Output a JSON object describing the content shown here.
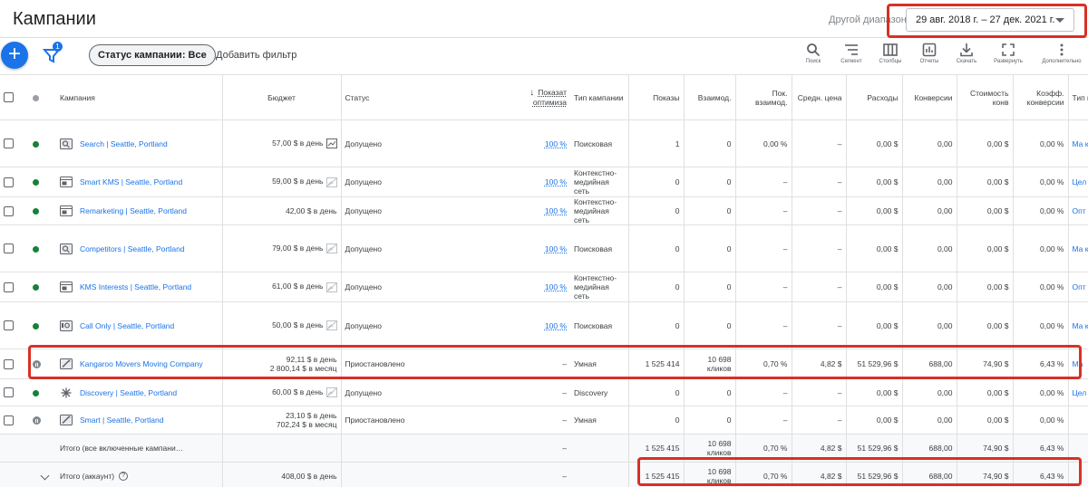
{
  "header": {
    "title": "Кампании",
    "date_range_label": "Другой диапазон",
    "date_range_value": "29 авг. 2018 г. – 27 дек. 2021 г."
  },
  "toolbar": {
    "add_label": "+",
    "filter_count": "1",
    "status_chip": "Статус кампании: Все",
    "add_filter": "Добавить фильтр",
    "tools": [
      {
        "label": "Поиск",
        "icon": "search-icon"
      },
      {
        "label": "Сегмент",
        "icon": "segment-icon"
      },
      {
        "label": "Столбцы",
        "icon": "columns-icon"
      },
      {
        "label": "Отчеты",
        "icon": "reports-icon"
      },
      {
        "label": "Скачать",
        "icon": "download-icon"
      },
      {
        "label": "Развернуть",
        "icon": "expand-icon"
      },
      {
        "label": "Дополнительно",
        "icon": "more-icon"
      }
    ]
  },
  "table": {
    "headers": {
      "campaign": "Кампания",
      "budget": "Бюджет",
      "status": "Статус",
      "opt_score": "Показат оптимиза",
      "type": "Тип кампании",
      "impr": "Показы",
      "interactions": "Взаимод.",
      "int_rate": "Пок. взаимод.",
      "avg_cost": "Средн. цена",
      "cost": "Расходы",
      "conv": "Конверсии",
      "cost_conv": "Стоимость конв",
      "conv_rate": "Коэфф. конверсии",
      "bid": "Тип назн стр"
    },
    "rows": [
      {
        "name": "Search | Seattle, Portland",
        "icon": "search-campaign-icon",
        "status_dot": "green",
        "budget1": "57,00 $ в день",
        "budget2": "",
        "budget_icon": "chart-icon",
        "status": "Допущено",
        "opt": "100 %",
        "type": "Поисковая",
        "impr": "1",
        "inter": "0",
        "int_rate": "0,00 %",
        "avg_cost": "–",
        "cost": "0,00 $",
        "conv": "0,00",
        "cost_conv": "0,00 $",
        "conv_rate": "0,00 %",
        "bid": "Ма кон (це из ста"
      },
      {
        "name": "Smart KMS | Seattle, Portland",
        "icon": "display-campaign-icon",
        "status_dot": "green",
        "budget1": "59,00 $ в день",
        "budget2": "",
        "budget_icon": "no-image-icon",
        "status": "Допущено",
        "opt": "100 %",
        "type": "Контекстно-медийная сеть",
        "impr": "0",
        "inter": "0",
        "int_rate": "–",
        "avg_cost": "–",
        "cost": "0,00 $",
        "conv": "0,00",
        "cost_conv": "0,00 $",
        "conv_rate": "0,00 %",
        "bid": "Цел за к"
      },
      {
        "name": "Remarketing | Seattle, Portland",
        "icon": "display-campaign-icon",
        "status_dot": "green",
        "budget1": "42,00 $ в день",
        "budget2": "",
        "budget_icon": "",
        "status": "Допущено",
        "opt": "100 %",
        "type": "Контекстно-медийная сеть",
        "impr": "0",
        "inter": "0",
        "int_rate": "–",
        "avg_cost": "–",
        "cost": "0,00 $",
        "conv": "0,00",
        "cost_conv": "0,00 $",
        "conv_rate": "0,00 %",
        "bid": "Опт"
      },
      {
        "name": "Competitors | Seattle, Portland",
        "icon": "search-campaign-icon",
        "status_dot": "green",
        "budget1": "79,00 $ в день",
        "budget2": "",
        "budget_icon": "no-image-icon",
        "status": "Допущено",
        "opt": "100 %",
        "type": "Поисковая",
        "impr": "0",
        "inter": "0",
        "int_rate": "–",
        "avg_cost": "–",
        "cost": "0,00 $",
        "conv": "0,00",
        "cost_conv": "0,00 $",
        "conv_rate": "0,00 %",
        "bid": "Ма кон (це из ста"
      },
      {
        "name": "KMS Interests | Seattle, Portland",
        "icon": "display-campaign-icon",
        "status_dot": "green",
        "budget1": "61,00 $ в день",
        "budget2": "",
        "budget_icon": "no-image-icon",
        "status": "Допущено",
        "opt": "100 %",
        "type": "Контекстно-медийная сеть",
        "impr": "0",
        "inter": "0",
        "int_rate": "–",
        "avg_cost": "–",
        "cost": "0,00 $",
        "conv": "0,00",
        "cost_conv": "0,00 $",
        "conv_rate": "0,00 %",
        "bid": "Опт"
      },
      {
        "name": "Call Only | Seattle, Portland",
        "icon": "call-campaign-icon",
        "status_dot": "green",
        "budget1": "50,00 $ в день",
        "budget2": "",
        "budget_icon": "no-image-icon",
        "status": "Допущено",
        "opt": "100 %",
        "type": "Поисковая",
        "impr": "0",
        "inter": "0",
        "int_rate": "–",
        "avg_cost": "–",
        "cost": "0,00 $",
        "conv": "0,00",
        "cost_conv": "0,00 $",
        "conv_rate": "0,00 %",
        "bid": "Ма кон (це из ста"
      },
      {
        "name": "Kangaroo Movers Moving Company",
        "icon": "smart-campaign-icon",
        "status_dot": "pause",
        "budget1": "92,11 $ в день",
        "budget2": "2 800,14 $ в месяц",
        "budget_icon": "",
        "status": "Приостановлено",
        "opt": "–",
        "type": "Умная",
        "impr": "1 525 414",
        "inter": "10 698 кликов",
        "int_rate": "0,70 %",
        "avg_cost": "4,82 $",
        "cost": "51 529,96 $",
        "conv": "688,00",
        "cost_conv": "74,90 $",
        "conv_rate": "6,43 %",
        "bid": "Ма"
      },
      {
        "name": "Discovery | Seattle, Portland",
        "icon": "discovery-campaign-icon",
        "status_dot": "green",
        "budget1": "60,00 $ в день",
        "budget2": "",
        "budget_icon": "no-image-icon",
        "status": "Допущено",
        "opt": "–",
        "type": "Discovery",
        "impr": "0",
        "inter": "0",
        "int_rate": "–",
        "avg_cost": "–",
        "cost": "0,00 $",
        "conv": "0,00",
        "cost_conv": "0,00 $",
        "conv_rate": "0,00 %",
        "bid": "Цел за"
      },
      {
        "name": "Smart | Seattle, Portland",
        "icon": "smart-campaign-icon",
        "status_dot": "pause",
        "budget1": "23,10 $ в день",
        "budget2": "702,24 $ в месяц",
        "budget_icon": "",
        "status": "Приостановлено",
        "opt": "–",
        "type": "Умная",
        "impr": "0",
        "inter": "0",
        "int_rate": "–",
        "avg_cost": "–",
        "cost": "0,00 $",
        "conv": "0,00",
        "cost_conv": "0,00 $",
        "conv_rate": "0,00 %",
        "bid": ""
      }
    ],
    "totals": [
      {
        "label": "Итого (все включенные кампани…",
        "budget": "",
        "opt": "–",
        "impr": "1 525 415",
        "inter": "10 698 кликов",
        "int_rate": "0,70 %",
        "avg_cost": "4,82 $",
        "cost": "51 529,96 $",
        "conv": "688,00",
        "cost_conv": "74,90 $",
        "conv_rate": "6,43 %"
      },
      {
        "label": "Итого (аккаунт)",
        "budget": "408,00 $ в день",
        "opt": "–",
        "impr": "1 525 415",
        "inter": "10 698 кликов",
        "int_rate": "0,70 %",
        "avg_cost": "4,82 $",
        "cost": "51 529,96 $",
        "conv": "688,00",
        "cost_conv": "74,90 $",
        "conv_rate": "6,43 %",
        "help": "?"
      }
    ]
  },
  "colors": {
    "accent": "#1a73e8",
    "enabled": "#188038",
    "paused": "#80868b",
    "highlight": "#d93025"
  }
}
